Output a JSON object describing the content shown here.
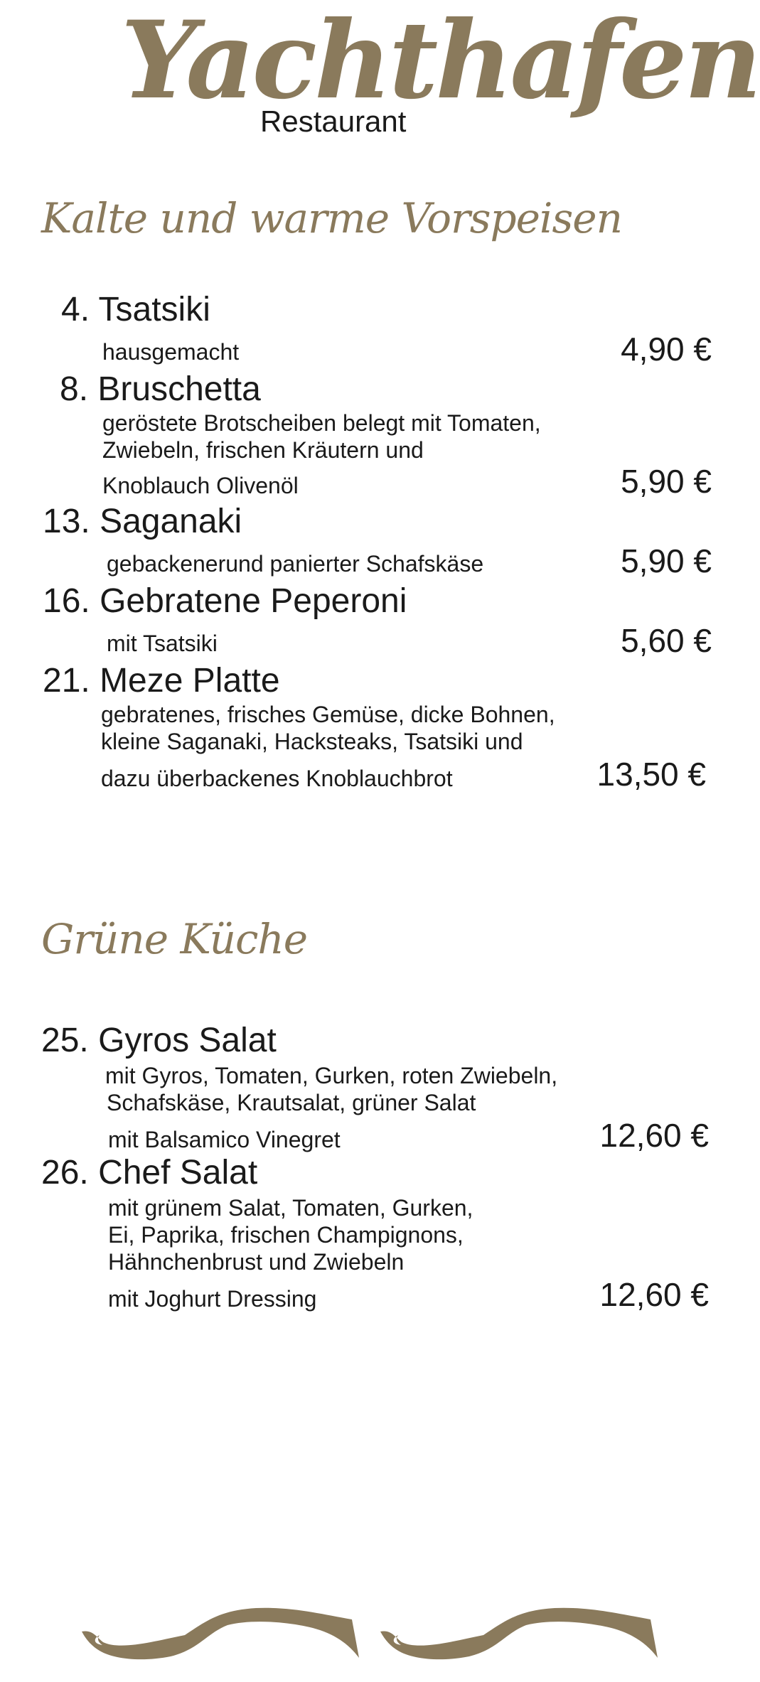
{
  "logo": {
    "script": "Yachthafen",
    "subtitle": "Restaurant"
  },
  "sections": [
    {
      "heading": "Kalte und warme Vorspeisen",
      "items": [
        {
          "title": "4. Tsatsiki",
          "desc": [
            "hausgemacht"
          ],
          "price": "4,90 €"
        },
        {
          "title": "8. Bruschetta",
          "desc": [
            "geröstete Brotscheiben belegt mit Tomaten,",
            "Zwiebeln, frischen Kräutern und",
            "Knoblauch Olivenöl"
          ],
          "price": "5,90 €"
        },
        {
          "title": "13. Saganaki",
          "desc": [
            "gebackenerund panierter  Schafskäse"
          ],
          "price": "5,90 €"
        },
        {
          "title": "16. Gebratene Peperoni",
          "desc": [
            "mit Tsatsiki"
          ],
          "price": "5,60 €"
        },
        {
          "title": "21. Meze Platte",
          "desc": [
            "gebratenes, frisches Gemüse, dicke Bohnen,",
            "kleine Saganaki, Hacksteaks, Tsatsiki und",
            "dazu überbackenes Knoblauchbrot"
          ],
          "price": "13,50 €"
        }
      ]
    },
    {
      "heading": "Grüne Küche",
      "items": [
        {
          "title": "25. Gyros Salat",
          "desc": [
            "mit Gyros, Tomaten, Gurken, roten Zwiebeln,",
            "Schafskäse, Krautsalat, grüner Salat",
            "mit Balsamico Vinegret"
          ],
          "price": "12,60 €"
        },
        {
          "title": "26. Chef Salat",
          "desc": [
            "mit grünem Salat, Tomaten, Gurken,",
            "Ei, Paprika, frischen Champignons,",
            "Hähnchenbrust und Zwiebeln",
            "mit Joghurt Dressing"
          ],
          "price": "12,60 €"
        }
      ]
    }
  ],
  "colors": {
    "accent": "#8a7a5c",
    "text": "#1a1a1a",
    "background": "#ffffff"
  },
  "icons": [
    "flourish-ornament-left",
    "flourish-ornament-right"
  ]
}
